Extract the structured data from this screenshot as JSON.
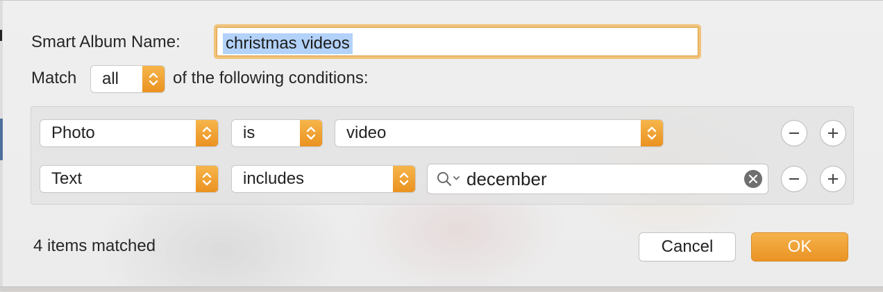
{
  "dialog": {
    "name_label": "Smart Album Name:",
    "name_value": "christmas videos",
    "match_label": "Match",
    "match_value": "all",
    "match_suffix": "of the following conditions:"
  },
  "conditions": [
    {
      "field": "Photo",
      "operator": "is",
      "value": "video"
    },
    {
      "field": "Text",
      "operator": "includes",
      "value": "december"
    }
  ],
  "footer": {
    "status": "4 items matched",
    "cancel_label": "Cancel",
    "ok_label": "OK"
  },
  "colors": {
    "accent": "#ED9A2C",
    "selection": "#B3D2F9"
  },
  "icons": [
    "stepper-icon",
    "search-icon",
    "clear-icon",
    "minus-icon",
    "plus-icon"
  ]
}
